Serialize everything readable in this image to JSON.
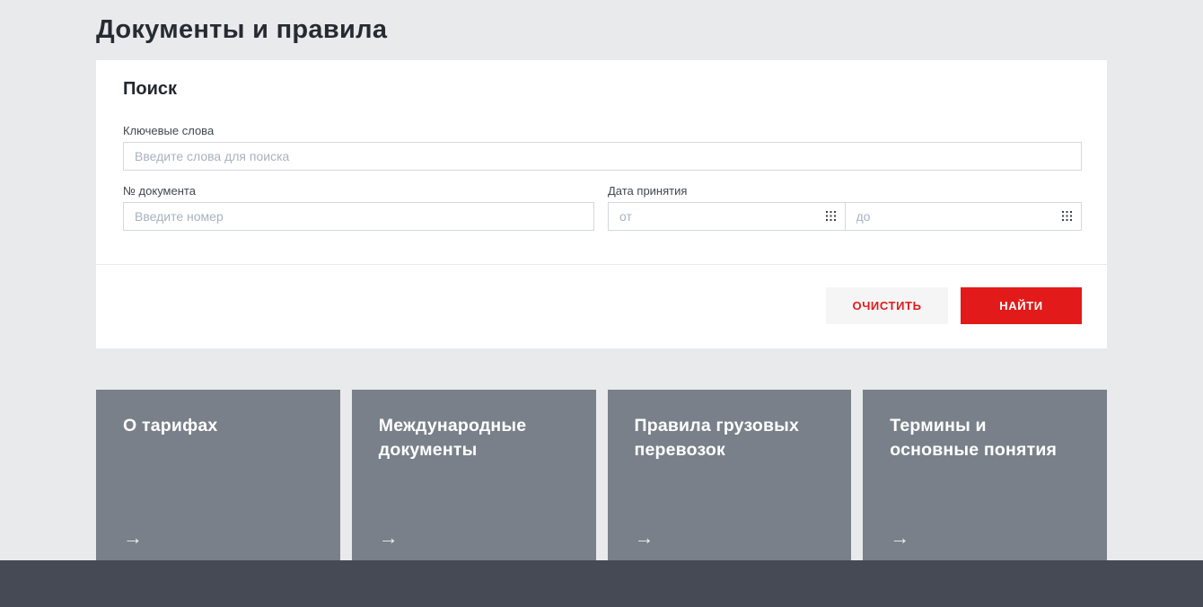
{
  "page": {
    "title": "Документы и правила"
  },
  "search_panel": {
    "heading": "Поиск",
    "keywords": {
      "label": "Ключевые слова",
      "placeholder": "Введите слова для поиска",
      "value": ""
    },
    "doc_number": {
      "label": "№ документа",
      "placeholder": "Введите номер",
      "value": ""
    },
    "date": {
      "label": "Дата принятия",
      "from_placeholder": "от",
      "to_placeholder": "до",
      "from_value": "",
      "to_value": ""
    },
    "buttons": {
      "clear_label": "ОЧИСТИТЬ",
      "find_label": "НАЙТИ"
    }
  },
  "cards": [
    {
      "title": "О тарифах",
      "arrow": "→"
    },
    {
      "title": "Международные документы",
      "arrow": "→"
    },
    {
      "title": "Правила грузовых перевозок",
      "arrow": "→"
    },
    {
      "title": "Термины и основные понятия",
      "arrow": "→"
    }
  ],
  "colors": {
    "accent_red": "#e21a1a",
    "card_gray": "#798089",
    "footer_dark": "#464a54",
    "page_bg": "#e9eaec"
  }
}
